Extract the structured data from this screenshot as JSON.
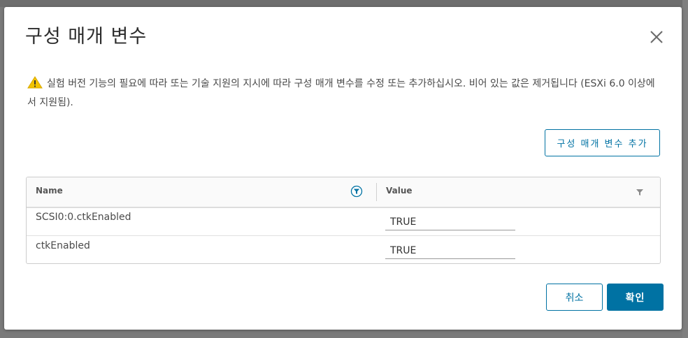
{
  "dialog": {
    "title": "구성 매개 변수",
    "warning_text": "실험 버전 기능의 필요에 따라 또는 기술 지원의 지시에 따라 구성 매개 변수를 수정 또는 추가하십시오. 비어 있는 값은 제거됩니다 (ESXi 6.0 이상에서 지원됨).",
    "add_button_label": "구성 매개 변수 추가",
    "cancel_label": "취소",
    "ok_label": "확인"
  },
  "grid": {
    "columns": [
      "Name",
      "Value"
    ],
    "rows": [
      {
        "name": "SCSI0:0.ctkEnabled",
        "value": "TRUE"
      },
      {
        "name": "ctkEnabled",
        "value": "TRUE"
      }
    ]
  },
  "colors": {
    "accent": "#0072a3",
    "warning": "#f2c300"
  },
  "icons": [
    "close-icon",
    "warning-icon",
    "filter-icon"
  ]
}
